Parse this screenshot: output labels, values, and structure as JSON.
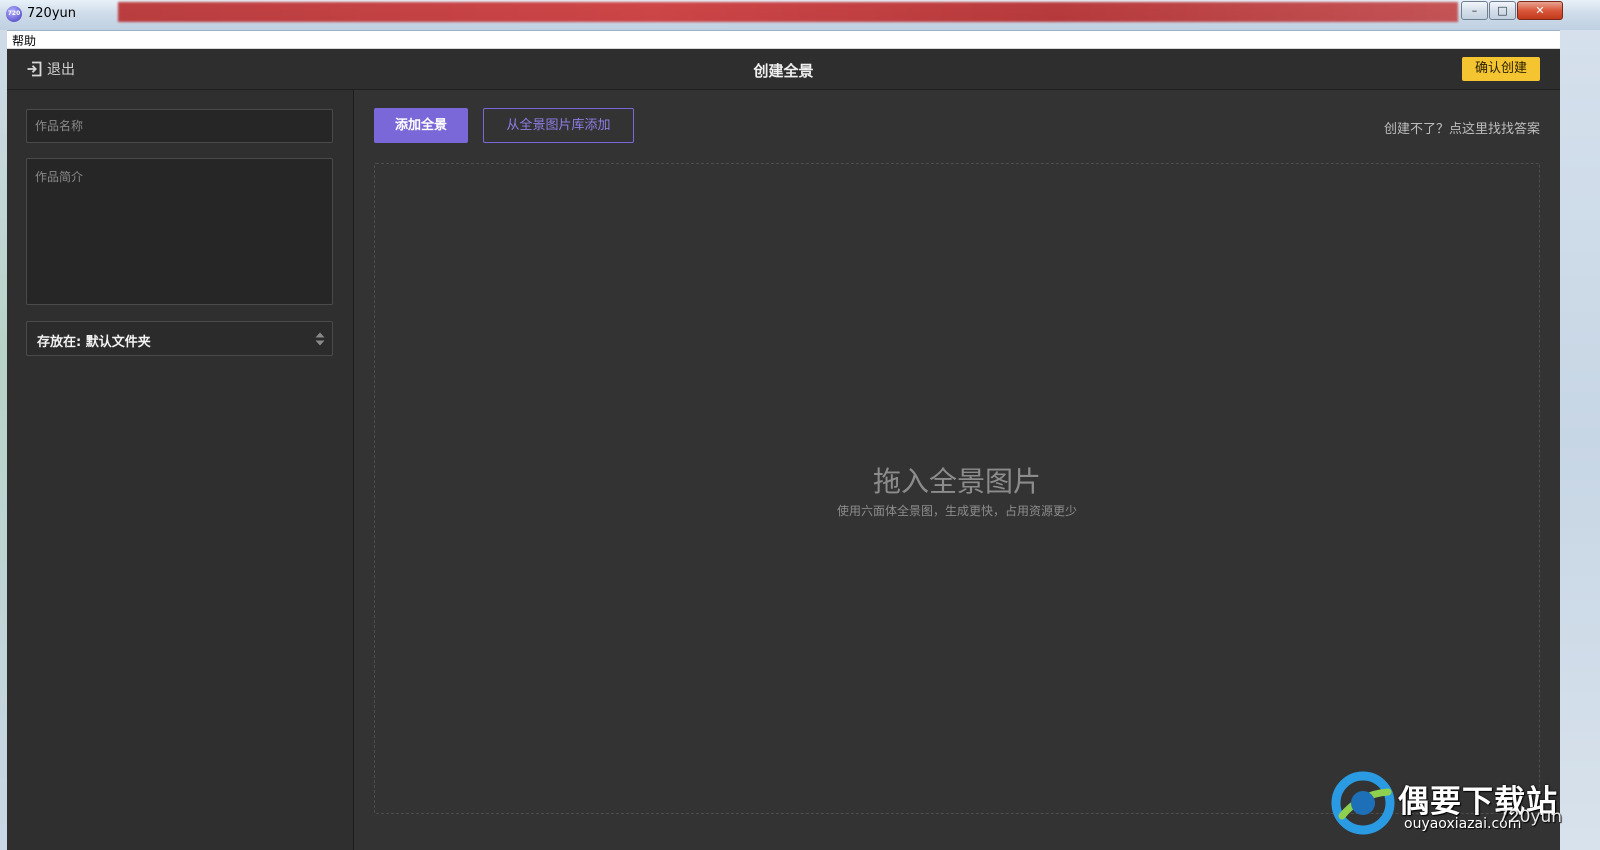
{
  "window": {
    "title": "720yun",
    "app_icon_text": "720",
    "controls": {
      "minimize_glyph": "–",
      "maximize_glyph": "□",
      "close_glyph": "✕"
    }
  },
  "menubar": {
    "items": [
      {
        "label": "帮助"
      }
    ]
  },
  "header": {
    "exit_label": "退出",
    "exit_icon": "logout-icon",
    "title": "创建全景",
    "confirm_label": "确认创建",
    "confirm_color": "#f5c431"
  },
  "form": {
    "name_placeholder": "作品名称",
    "name_value": "",
    "desc_placeholder": "作品简介",
    "desc_value": "",
    "folder_label": "存放在: 默认文件夹",
    "folder_icon": "updown-arrows-icon"
  },
  "main": {
    "add_pano_label": "添加全景",
    "from_library_label": "从全景图片库添加",
    "help_link": "创建不了？点这里找找答案",
    "accent_color": "#7b68d8",
    "drop_title": "拖入全景图片",
    "drop_hint": "使用六面体全景图，生成更快，占用资源更少"
  },
  "watermark": {
    "brand": "偶要下载站",
    "url": "ouyaoxiazai.com",
    "brand_small": "720yun"
  }
}
